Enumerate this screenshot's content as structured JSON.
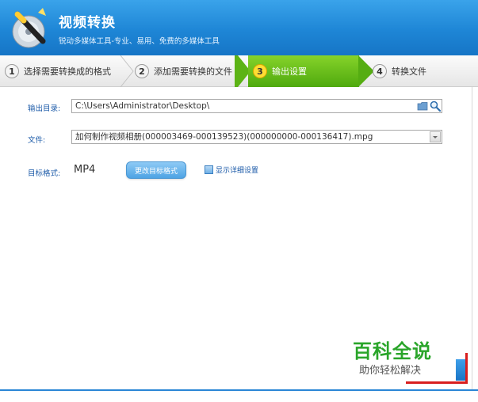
{
  "header": {
    "title": "视频转换",
    "subtitle": "锐动多媒体工具-专业、易用、免费的多媒体工具"
  },
  "steps": [
    {
      "num": "1",
      "label": "选择需要转换成的格式"
    },
    {
      "num": "2",
      "label": "添加需要转换的文件"
    },
    {
      "num": "3",
      "label": "输出设置"
    },
    {
      "num": "4",
      "label": "转换文件"
    }
  ],
  "active_step": 3,
  "form": {
    "output_dir_label": "输出目录:",
    "output_dir_value": "C:\\Users\\Administrator\\Desktop\\",
    "file_label": "文件:",
    "file_value": "加何制作视频相册(000003469-000139523)(000000000-000136417).mpg",
    "target_format_label": "目标格式:",
    "target_format_value": "MP4",
    "change_format_button": "更改目标格式",
    "show_details_label": "显示详细设置"
  },
  "watermark": {
    "title": "百科全说",
    "subtitle": "助你轻松解决"
  },
  "colors": {
    "header_blue": "#1e86d6",
    "active_step_green": "#5cb315",
    "label_blue": "#1b5aa8",
    "watermark_green": "#2aa52a",
    "highlight_red": "#d81e1e"
  }
}
